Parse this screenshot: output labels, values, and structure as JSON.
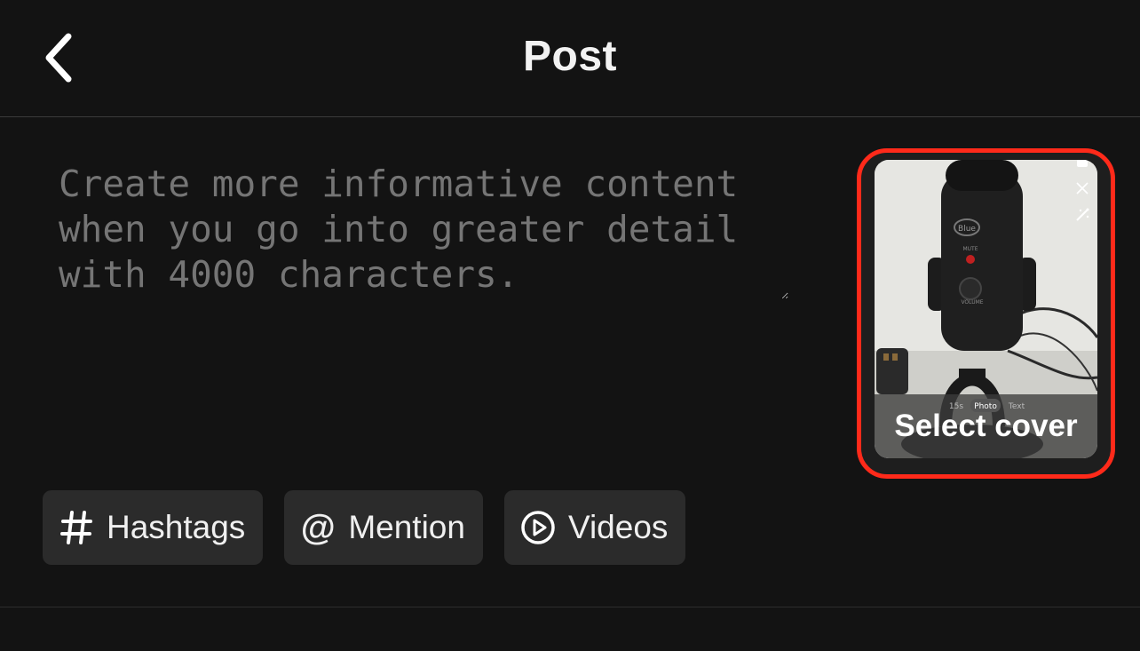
{
  "header": {
    "back_icon": "chevron-left-icon",
    "title": "Post"
  },
  "caption": {
    "placeholder": "Create more informative content when you go into greater detail with 4000 characters."
  },
  "cover": {
    "label": "Select cover",
    "highlight_color": "#ff2a1a",
    "thumbnail_mode_tabs": [
      "15s",
      "Photo",
      "Text"
    ],
    "thumbnail_selected_mode": "Photo",
    "mic_labels": [
      "Blue",
      "MUTE",
      "VOLUME"
    ]
  },
  "chips": [
    {
      "icon": "hashtag-icon",
      "label": "Hashtags"
    },
    {
      "icon": "at-sign-icon",
      "label": "Mention"
    },
    {
      "icon": "play-circle-icon",
      "label": "Videos"
    }
  ]
}
